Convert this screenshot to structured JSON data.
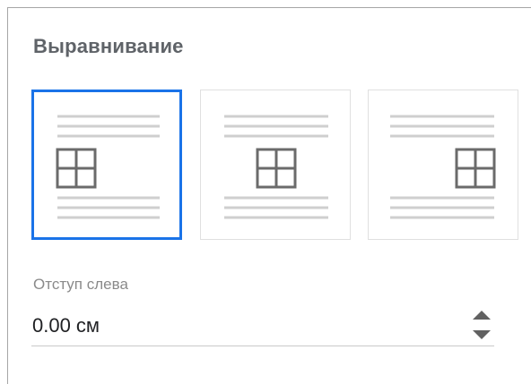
{
  "section": {
    "heading": "Выравнивание"
  },
  "alignment": {
    "options": [
      {
        "name": "align-left",
        "selected": true
      },
      {
        "name": "align-center",
        "selected": false
      },
      {
        "name": "align-right",
        "selected": false
      }
    ],
    "selected_color": "#1a73e8"
  },
  "indent": {
    "label": "Отступ слева",
    "value": "0.00 см",
    "icons": {
      "up": "triangle-up-icon",
      "down": "triangle-down-icon"
    }
  }
}
